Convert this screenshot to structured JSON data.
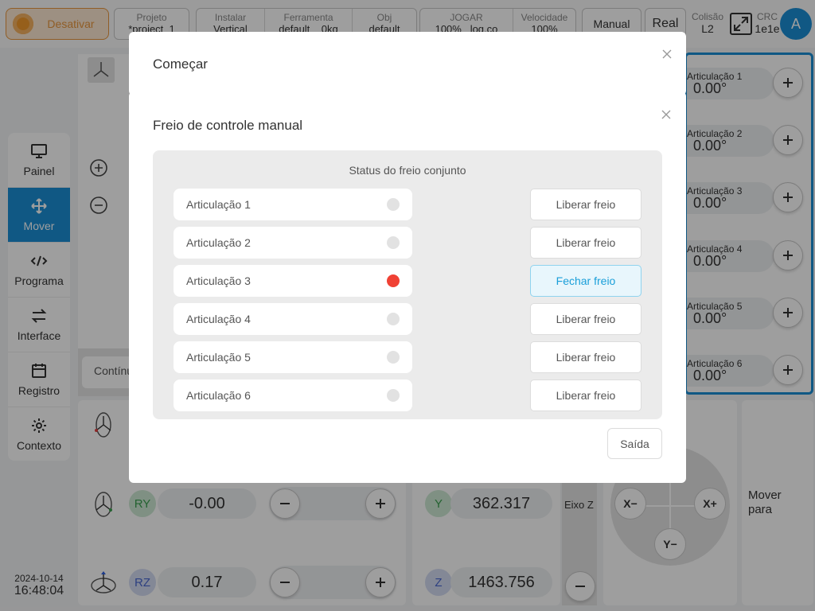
{
  "topbar": {
    "deactivate_label": "Desativar",
    "project": {
      "title": "Projeto",
      "value": "*project_1"
    },
    "install": [
      {
        "title": "Instalar",
        "value": "Vertical"
      },
      {
        "title": "Ferramenta",
        "value": "default"
      },
      {
        "extra": "0kg"
      },
      {
        "title": "Obj",
        "value": "default"
      }
    ],
    "jog": [
      {
        "title": "JOGAR",
        "value": "100%",
        "extra": "log.co"
      },
      {
        "title": "Velocidade",
        "value": "100%"
      }
    ],
    "manual_label": "Manual",
    "real_label": "Real",
    "collision": {
      "title": "Colisão",
      "value": "L2"
    },
    "crc": {
      "title": "CRC",
      "value": "1e1e"
    },
    "avatar_letter": "A"
  },
  "nav": {
    "items": [
      {
        "label": "Painel",
        "icon": "monitor-icon"
      },
      {
        "label": "Mover",
        "icon": "move-icon"
      },
      {
        "label": "Programa",
        "icon": "code-icon"
      },
      {
        "label": "Interface",
        "icon": "swap-icon"
      },
      {
        "label": "Registro",
        "icon": "calendar-icon"
      },
      {
        "label": "Contexto",
        "icon": "gear-icon"
      }
    ],
    "active_index": 1
  },
  "datetime": {
    "date": "2024-10-14",
    "time": "16:48:04"
  },
  "workspace": {
    "continuous_label": "Contínuo",
    "joints": [
      {
        "label": "Articulação 1",
        "value": "0.00°"
      },
      {
        "label": "Articulação 2",
        "value": "0.00°"
      },
      {
        "label": "Articulação 3",
        "value": "0.00°"
      },
      {
        "label": "Articulação 4",
        "value": "0.00°"
      },
      {
        "label": "Articulação 5",
        "value": "0.00°"
      },
      {
        "label": "Articulação 6",
        "value": "0.00°"
      }
    ],
    "rotation": [
      {
        "axis": "RY",
        "value": "-0.00"
      },
      {
        "axis": "RZ",
        "value": "0.17"
      }
    ],
    "position": [
      {
        "axis": "Y",
        "value": "362.317"
      },
      {
        "axis": "Z",
        "value": "1463.756"
      }
    ],
    "z_axis_label": "Eixo Z",
    "joystick": {
      "left": "X−",
      "right": "X+",
      "bottom": "Y−"
    },
    "move_to_label": "Mover para"
  },
  "start_dialog": {
    "title": "Começar"
  },
  "brake_dialog": {
    "title": "Freio de controle manual",
    "header": "Status do freio conjunto",
    "rows": [
      {
        "name": "Articulação 1",
        "status": "off",
        "button": "Liberar freio"
      },
      {
        "name": "Articulação 2",
        "status": "off",
        "button": "Liberar freio"
      },
      {
        "name": "Articulação 3",
        "status": "on",
        "button": "Fechar freio"
      },
      {
        "name": "Articulação 4",
        "status": "off",
        "button": "Liberar freio"
      },
      {
        "name": "Articulação 5",
        "status": "off",
        "button": "Liberar freio"
      },
      {
        "name": "Articulação 6",
        "status": "off",
        "button": "Liberar freio"
      }
    ],
    "exit_label": "Saída"
  },
  "colors": {
    "accent": "#1a8fd6",
    "status_on": "#f04134",
    "status_off": "#e2e2e2",
    "warn": "#e8963e"
  }
}
